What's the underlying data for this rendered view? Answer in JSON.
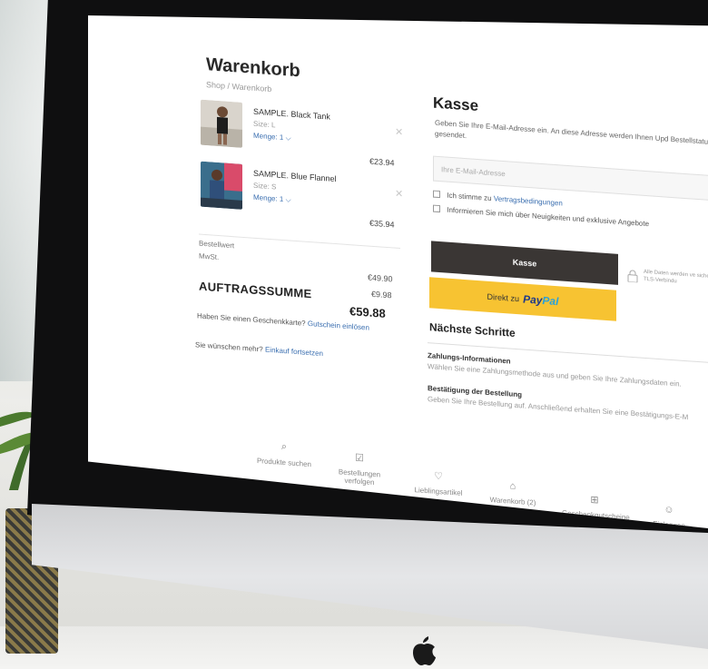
{
  "cart": {
    "title": "Warenkorb",
    "breadcrumb": "Shop / Warenkorb",
    "items": [
      {
        "name": "SAMPLE. Black Tank",
        "size": "Size: L",
        "qty": "Menge: 1 ⌵",
        "price": "€23.94"
      },
      {
        "name": "SAMPLE. Blue Flannel",
        "size": "Size: S",
        "qty": "Menge: 1 ⌵",
        "price": "€35.94"
      }
    ],
    "summary": {
      "order_value_label": "Bestellwert",
      "order_value": "€49.90",
      "vat_label": "MwSt.",
      "vat": "€9.98",
      "total_label": "AUFTRAGSSUMME",
      "total": "€59.88"
    },
    "gift_card_prompt": "Haben Sie einen Geschenkkarte?",
    "gift_card_link": "Gutschein einlösen",
    "more_prompt": "Sie wünschen mehr?",
    "continue_link": "Einkauf fortsetzen"
  },
  "checkout": {
    "title": "Kasse",
    "description": "Geben Sie Ihre E-Mail-Adresse ein. An diese Adresse werden Ihnen Upd Bestellstatus gesendet.",
    "email_placeholder": "Ihre E-Mail-Adresse",
    "terms_prefix": "Ich stimme zu",
    "terms_link": "Vertragsbedingungen",
    "newsletter": "Informieren Sie mich über Neuigkeiten und exklusive Angebote",
    "checkout_button": "Kasse",
    "paypal_prefix": "Direkt zu",
    "paypal_word_a": "Pay",
    "paypal_word_b": "Pal",
    "secure_note": "Alle Daten werden ve sichere TLS-Verbindu"
  },
  "next_steps": {
    "title": "Nächste Schritte",
    "steps": [
      {
        "heading": "Zahlungs-Informationen",
        "text": "Wählen Sie eine Zahlungsmethode aus und geben Sie Ihre Zahlungsdaten ein."
      },
      {
        "heading": "Bestätigung der Bestellung",
        "text": "Geben Sie Ihre Bestellung auf. Anschließend erhalten Sie eine Bestätigungs-E-M"
      }
    ]
  },
  "bottom_nav": [
    {
      "label": "Produkte suchen",
      "icon": "search-icon",
      "glyph": "⌕"
    },
    {
      "label": "Bestellungen verfolgen",
      "icon": "order-track-icon",
      "glyph": "☑"
    },
    {
      "label": "Lieblingsartikel",
      "icon": "heart-icon",
      "glyph": "♡"
    },
    {
      "label": "Warenkorb (2)",
      "icon": "shopping-bag-icon",
      "glyph": "⌂"
    },
    {
      "label": "Geschenkgutscheine",
      "icon": "gift-card-icon",
      "glyph": "⊞"
    },
    {
      "label": "Einloggen",
      "icon": "user-icon",
      "glyph": "☺"
    }
  ],
  "colors": {
    "checkout_button": "#3a3634",
    "paypal_button": "#f7c332",
    "link": "#3b6fb0"
  }
}
